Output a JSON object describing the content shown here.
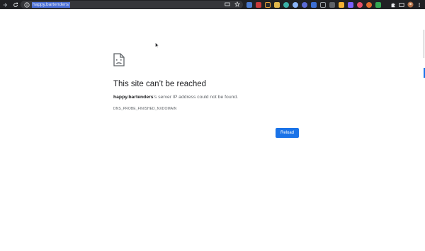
{
  "browser": {
    "url": "happy.bartenders/"
  },
  "error": {
    "title": "This site can’t be reached",
    "host": "happy.bartenders",
    "message_suffix": "’s server IP address could not be found.",
    "code": "DNS_PROBE_FINISHED_NXDOMAIN",
    "reload_label": "Reload"
  },
  "colors": {
    "toolbar_bg": "#202124",
    "omnibox_bg": "#35363a",
    "accent": "#1a73e8",
    "title_text": "#202124",
    "body_text": "#5f6368"
  },
  "icons": [
    "forward-icon",
    "reload-icon",
    "info-icon",
    "cast-icon",
    "bookmark-star-icon",
    "extensions-puzzle-icon",
    "profile-avatar-icon",
    "more-menu-icon",
    "sad-page-icon"
  ]
}
